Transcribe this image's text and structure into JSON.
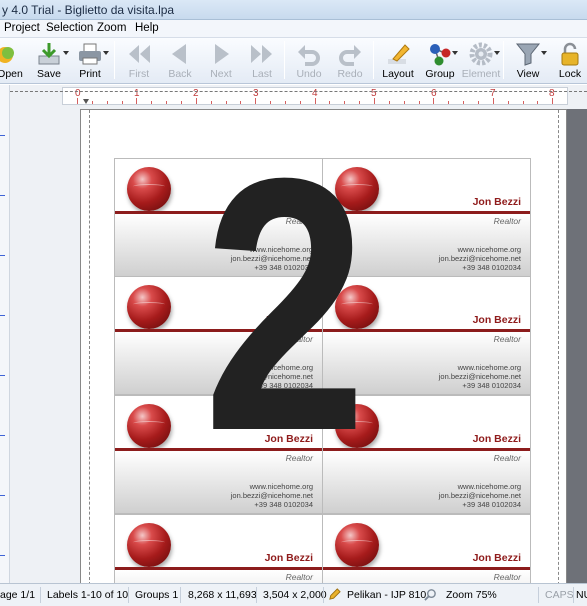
{
  "titlebar": {
    "title": "y 4.0 Trial - Biglietto da visita.lpa"
  },
  "menu": {
    "project": "Project",
    "selection": "Selection",
    "zoom": "Zoom",
    "help": "Help"
  },
  "toolbar": {
    "open": "Open",
    "save": "Save",
    "print": "Print",
    "first": "First",
    "back": "Back",
    "next": "Next",
    "last": "Last",
    "undo": "Undo",
    "redo": "Redo",
    "layout": "Layout",
    "group": "Group",
    "element": "Element",
    "view": "View",
    "lock": "Lock"
  },
  "ruler": {
    "numbers": [
      "0",
      "1",
      "2",
      "3",
      "4",
      "5",
      "6",
      "7",
      "8"
    ]
  },
  "card": {
    "name": "Jon Bezzi",
    "title": "Realtor",
    "website": "www.nicehome.org",
    "email": "jon.bezzi@nicehome.net",
    "phone": "+39 348 0102034"
  },
  "overlay": {
    "number": "2"
  },
  "status": {
    "page": "age 1/1",
    "labels": "Labels 1-10 of 10",
    "groups": "Groups 1",
    "page_size": "8,268 x 11,693",
    "label_size": "3,504 x 2,000",
    "template": "Pelikan - IJP 810",
    "zoom": "Zoom 75%",
    "caps": "CAPS",
    "num": "NU"
  },
  "colors": {
    "accent": "#8c1c1c",
    "name": "#8f1b1b",
    "ruler": "#c23b3b"
  }
}
